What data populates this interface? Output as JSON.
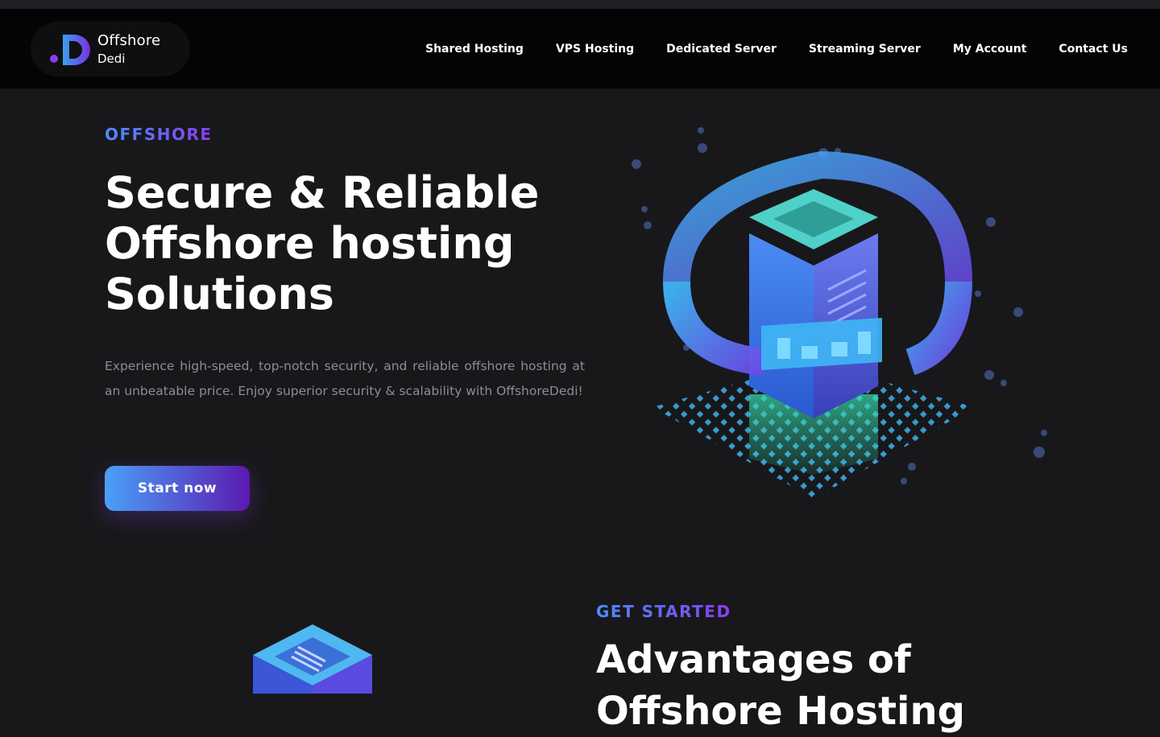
{
  "brand": {
    "name_line1": "Offshore",
    "name_line2": "Dedi",
    "colors": {
      "accent_blue": "#4c8dff",
      "accent_purple": "#8a3cf0"
    }
  },
  "nav": {
    "items": [
      {
        "label": "Shared Hosting"
      },
      {
        "label": "VPS Hosting"
      },
      {
        "label": "Dedicated Server"
      },
      {
        "label": "Streaming Server"
      },
      {
        "label": "My Account"
      },
      {
        "label": "Contact Us"
      }
    ]
  },
  "hero": {
    "eyebrow": "OFFSHORE",
    "title_line1": "Secure & Reliable",
    "title_line2": "Offshore hosting",
    "title_line3": "Solutions",
    "description": "Experience high-speed, top-notch security, and reliable offshore hosting at an unbeatable price. Enjoy superior security & scalability with OffshoreDedi!",
    "cta_label": "Start now",
    "illustration_icon": "isometric-server-icon"
  },
  "section2": {
    "eyebrow": "GET STARTED",
    "title_line1": "Advantages of",
    "title_line2": "Offshore Hosting",
    "illustration_icon": "isometric-server-icon"
  }
}
